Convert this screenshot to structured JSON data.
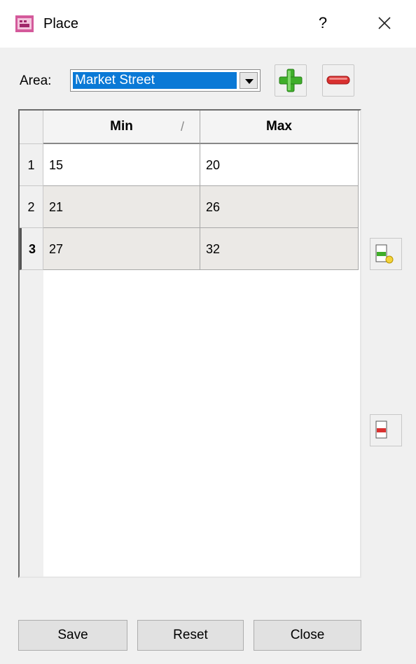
{
  "window": {
    "title": "Place",
    "help_label": "?"
  },
  "area": {
    "label": "Area:",
    "selected": "Market Street"
  },
  "table": {
    "columns": [
      "Min",
      "Max"
    ],
    "sort_indicator": "/",
    "rows": [
      {
        "index": "1",
        "min": "15",
        "max": "20"
      },
      {
        "index": "2",
        "min": "21",
        "max": "26"
      },
      {
        "index": "3",
        "min": "27",
        "max": "32"
      }
    ]
  },
  "buttons": {
    "save": "Save",
    "reset": "Reset",
    "close": "Close"
  },
  "icons": {
    "app": "place-app-icon",
    "add": "green-plus-icon",
    "remove": "red-minus-icon",
    "add_row": "add-row-icon",
    "delete_row": "delete-row-icon",
    "close": "close-icon"
  },
  "colors": {
    "selection": "#0a79d6",
    "add_green": "#3fae2a",
    "remove_red": "#d9302f",
    "alt_row": "#ebe9e6"
  }
}
